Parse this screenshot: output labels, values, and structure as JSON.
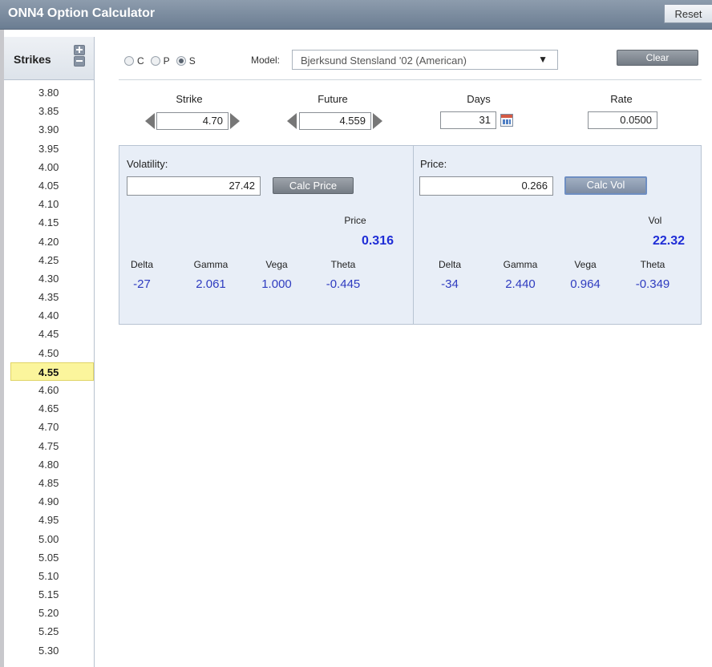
{
  "app": {
    "title": "ONN4 Option Calculator",
    "reset_label": "Reset"
  },
  "strikes": {
    "title": "Strikes",
    "selected": "4.55",
    "items": [
      "3.80",
      "3.85",
      "3.90",
      "3.95",
      "4.00",
      "4.05",
      "4.10",
      "4.15",
      "4.20",
      "4.25",
      "4.30",
      "4.35",
      "4.40",
      "4.45",
      "4.50",
      "4.55",
      "4.60",
      "4.65",
      "4.70",
      "4.75",
      "4.80",
      "4.85",
      "4.90",
      "4.95",
      "5.00",
      "5.05",
      "5.10",
      "5.15",
      "5.20",
      "5.25",
      "5.30"
    ]
  },
  "controls": {
    "radios": [
      {
        "label": "C",
        "selected": false
      },
      {
        "label": "P",
        "selected": false
      },
      {
        "label": "S",
        "selected": true
      }
    ],
    "model_label": "Model:",
    "model_value": "Bjerksund Stensland '02 (American)",
    "clear_label": "Clear"
  },
  "fields": {
    "strike": {
      "label": "Strike",
      "value": "4.70"
    },
    "future": {
      "label": "Future",
      "value": "4.559"
    },
    "days": {
      "label": "Days",
      "value": "31"
    },
    "rate": {
      "label": "Rate",
      "value": "0.0500"
    }
  },
  "vol_panel": {
    "label": "Volatility:",
    "value": "27.42",
    "button": "Calc Price",
    "result_label": "Price",
    "result_value": "0.316",
    "greeks": [
      {
        "label": "Delta",
        "value": "-27"
      },
      {
        "label": "Gamma",
        "value": "2.061"
      },
      {
        "label": "Vega",
        "value": "1.000"
      },
      {
        "label": "Theta",
        "value": "-0.445"
      }
    ]
  },
  "price_panel": {
    "label": "Price:",
    "value": "0.266",
    "button": "Calc Vol",
    "result_label": "Vol",
    "result_value": "22.32",
    "greeks": [
      {
        "label": "Delta",
        "value": "-34"
      },
      {
        "label": "Gamma",
        "value": "2.440"
      },
      {
        "label": "Vega",
        "value": "0.964"
      },
      {
        "label": "Theta",
        "value": "-0.349"
      }
    ]
  }
}
